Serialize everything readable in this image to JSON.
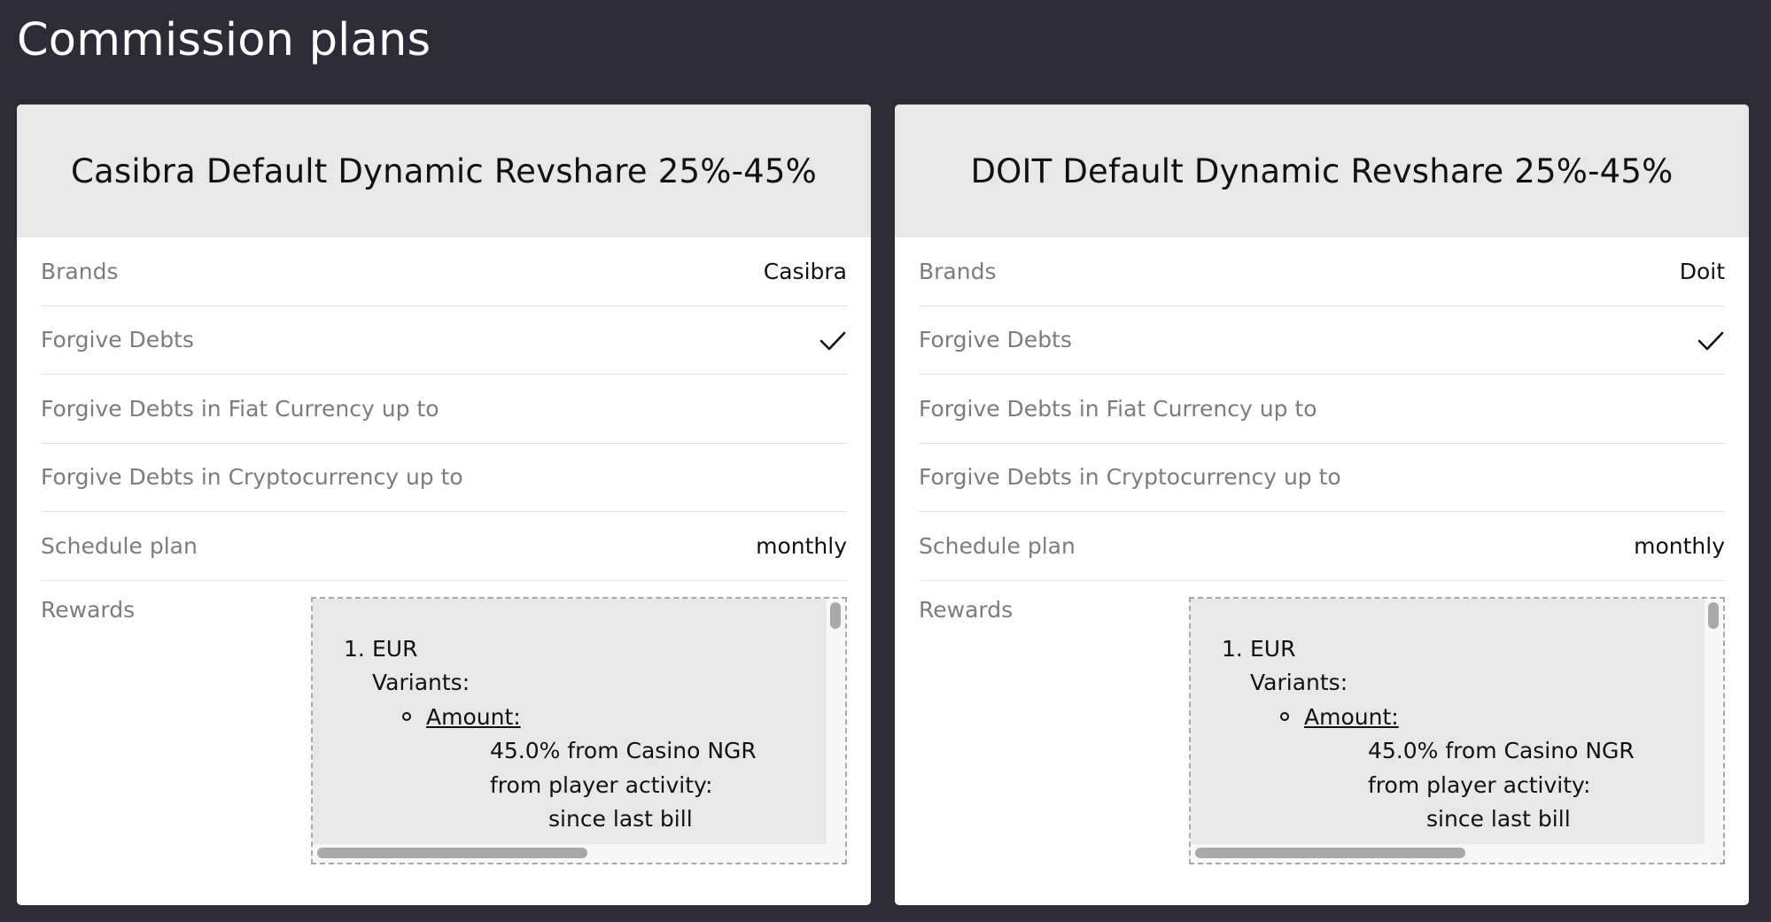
{
  "page": {
    "title": "Commission plans"
  },
  "icons": {
    "check": "checkmark-icon"
  },
  "colors": {
    "background": "#2c2b36",
    "header": "#e8e8e8",
    "label": "#7c7c7c"
  },
  "plans": [
    {
      "title": "Casibra Default Dynamic Revshare 25%-45%",
      "rows": {
        "brands": {
          "label": "Brands",
          "value": "Casibra"
        },
        "forgive_debts": {
          "label": "Forgive Debts",
          "checked": true
        },
        "forgive_fiat": {
          "label": "Forgive Debts in Fiat Currency up to",
          "value": ""
        },
        "forgive_crypto": {
          "label": "Forgive Debts in Cryptocurrency up to",
          "value": ""
        },
        "schedule": {
          "label": "Schedule plan",
          "value": "monthly"
        }
      },
      "rewards": {
        "label": "Rewards",
        "number": "1.",
        "currency": "EUR",
        "variants_label": "Variants:",
        "amount_label": "Amount:",
        "amount_value": "45.0% from Casino NGR",
        "activity_label": "from player activity:",
        "activity_value": "since last bill"
      }
    },
    {
      "title": "DOIT Default Dynamic Revshare 25%-45%",
      "rows": {
        "brands": {
          "label": "Brands",
          "value": "Doit"
        },
        "forgive_debts": {
          "label": "Forgive Debts",
          "checked": true
        },
        "forgive_fiat": {
          "label": "Forgive Debts in Fiat Currency up to",
          "value": ""
        },
        "forgive_crypto": {
          "label": "Forgive Debts in Cryptocurrency up to",
          "value": ""
        },
        "schedule": {
          "label": "Schedule plan",
          "value": "monthly"
        }
      },
      "rewards": {
        "label": "Rewards",
        "number": "1.",
        "currency": "EUR",
        "variants_label": "Variants:",
        "amount_label": "Amount:",
        "amount_value": "45.0% from Casino NGR",
        "activity_label": "from player activity:",
        "activity_value": "since last bill"
      }
    }
  ]
}
